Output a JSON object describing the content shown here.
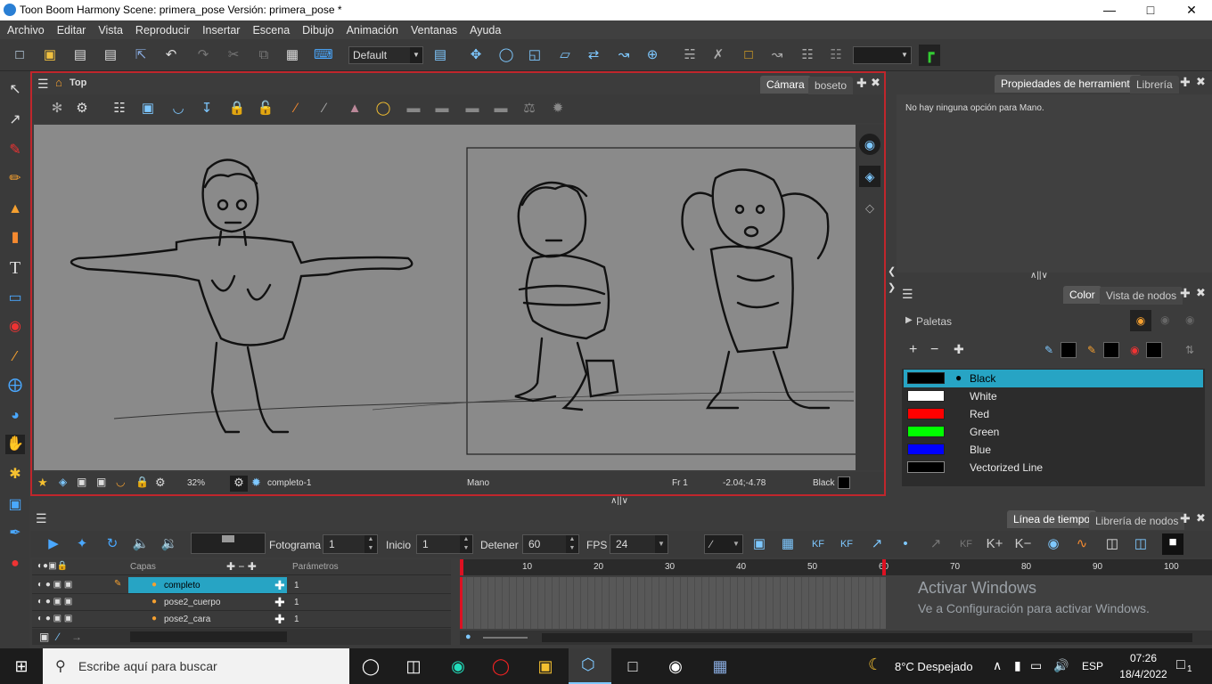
{
  "window": {
    "title": "Toon Boom Harmony Scene: primera_pose Versión: primera_pose *"
  },
  "menu": [
    "Archivo",
    "Editar",
    "Vista",
    "Reproducir",
    "Insertar",
    "Escena",
    "Dibujo",
    "Animación",
    "Ventanas",
    "Ayuda"
  ],
  "toolbar": {
    "preset": "Default"
  },
  "viewport": {
    "view_label": "Top",
    "tabs": [
      "Cámara",
      "boseto"
    ],
    "zoom": "32%",
    "drawing": "completo-1",
    "tool": "Mano",
    "frame": "Fr 1",
    "coords": "-2.04;-4.78",
    "current_color": "Black"
  },
  "tool_properties": {
    "tabs": [
      "Propiedades de herramienta",
      "Librería"
    ],
    "message": "No hay ninguna opción para Mano."
  },
  "color_panel": {
    "tabs": [
      "Color",
      "Vista de nodos"
    ],
    "palettes_label": "Paletas",
    "swatches": [
      {
        "name": "Black",
        "color": "#000000",
        "selected": true
      },
      {
        "name": "White",
        "color": "#ffffff"
      },
      {
        "name": "Red",
        "color": "#ff0000"
      },
      {
        "name": "Green",
        "color": "#00ff00"
      },
      {
        "name": "Blue",
        "color": "#0000ff"
      },
      {
        "name": "Vectorized Line",
        "color": "#000000"
      }
    ]
  },
  "timeline": {
    "tabs": [
      "Línea de tiempo",
      "Librería de nodos"
    ],
    "frame_label": "Fotograma",
    "frame_value": "1",
    "start_label": "Inicio",
    "start_value": "1",
    "stop_label": "Detener",
    "stop_value": "60",
    "fps_label": "FPS",
    "fps_value": "24",
    "layers_header": "Capas",
    "params_header": "Parámetros",
    "layers": [
      {
        "name": "completo",
        "param": "1",
        "selected": true
      },
      {
        "name": "pose2_cuerpo",
        "param": "1"
      },
      {
        "name": "pose2_cara",
        "param": "1"
      }
    ],
    "ruler": [
      "10",
      "20",
      "30",
      "40",
      "50",
      "60",
      "70",
      "80",
      "90",
      "100"
    ]
  },
  "watermark": {
    "title": "Activar Windows",
    "subtitle": "Ve a Configuración para activar Windows."
  },
  "taskbar": {
    "search_placeholder": "Escribe aquí para buscar",
    "weather": "8°C  Despejado",
    "lang": "ESP",
    "time": "07:26",
    "date": "18/4/2022",
    "notifications": "1"
  }
}
